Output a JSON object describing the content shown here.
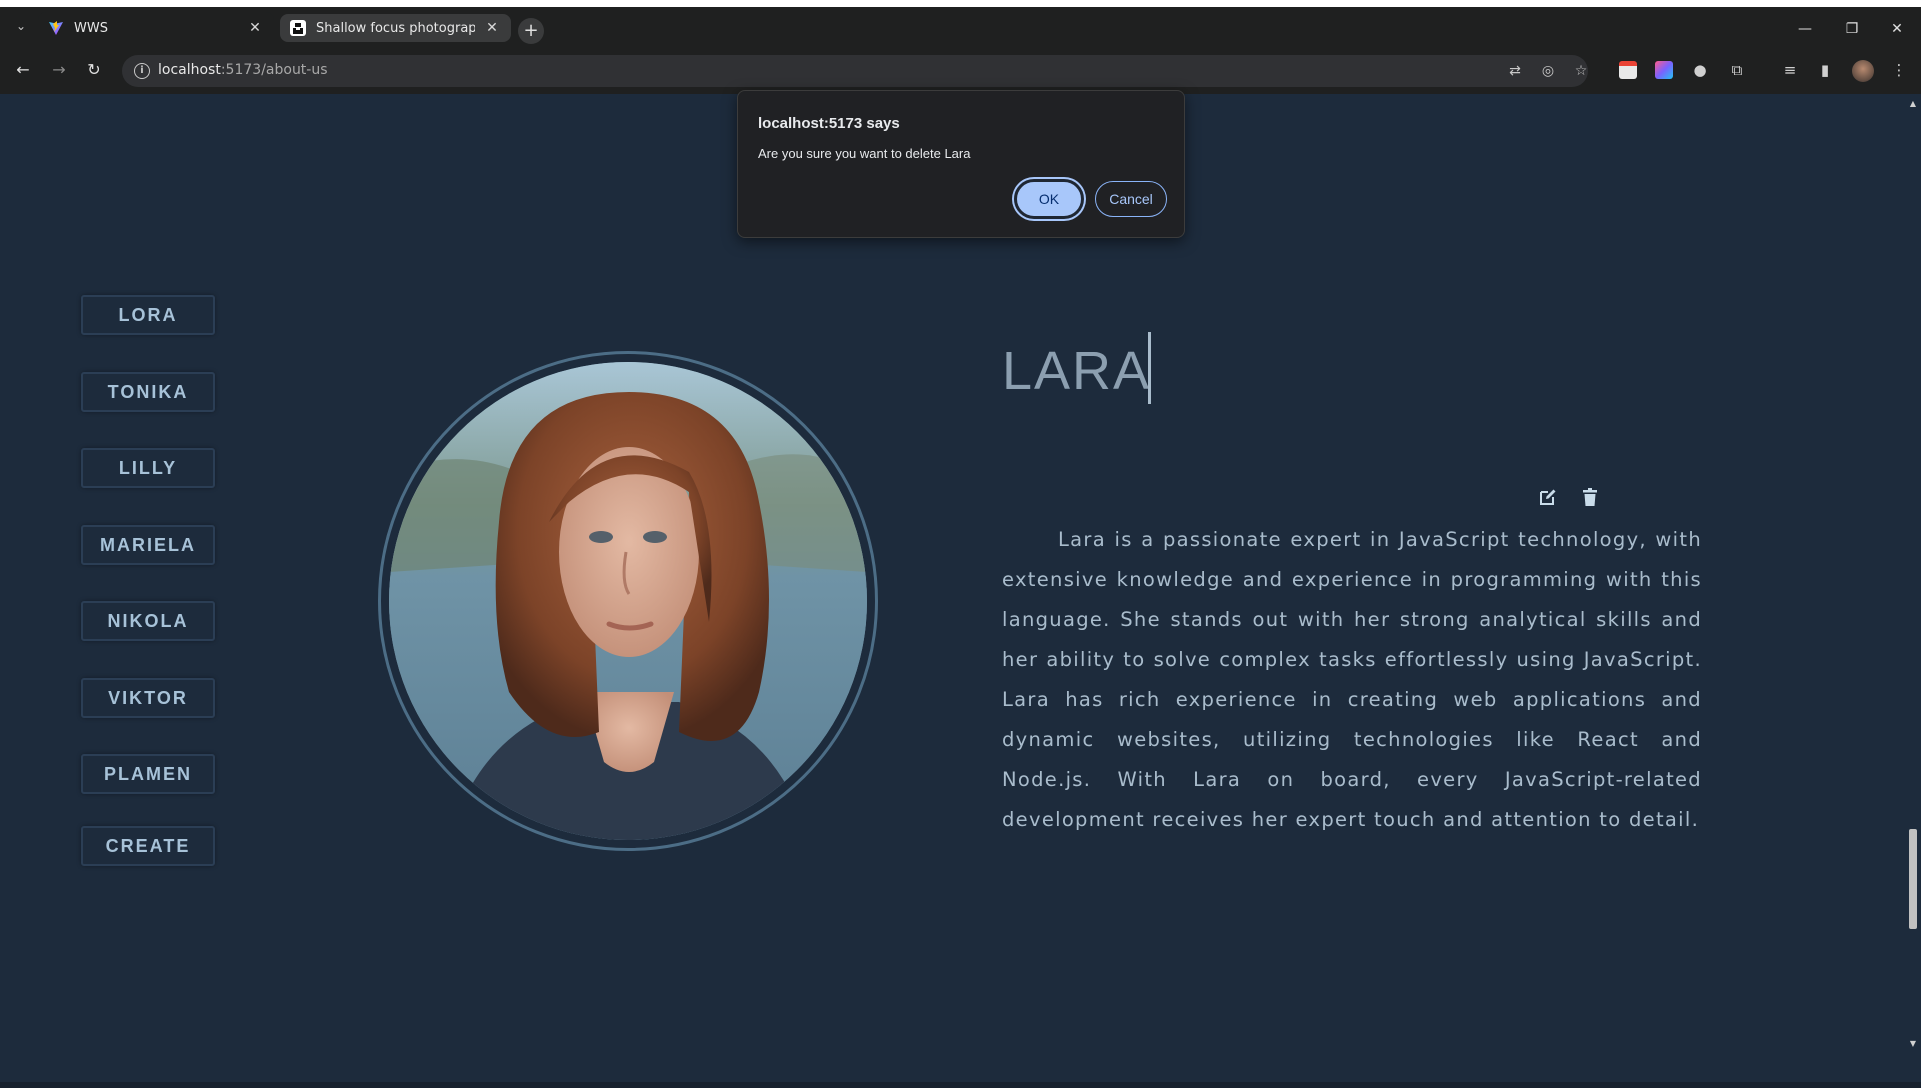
{
  "browser": {
    "tabs": [
      {
        "title": "WWS",
        "active": true
      },
      {
        "title": "Shallow focus photography of w",
        "active": false
      }
    ],
    "url_host": "localhost",
    "url_path": ":5173/about-us"
  },
  "dialog": {
    "title": "localhost:5173 says",
    "message": "Are you sure you want to delete Lara",
    "ok_label": "OK",
    "cancel_label": "Cancel"
  },
  "nav": {
    "items": [
      "LORA",
      "TONIKA",
      "LILLY",
      "MARIELA",
      "NIKOLA",
      "VIKTOR",
      "PLAMEN",
      "CREATE"
    ]
  },
  "profile": {
    "name": "LARA",
    "bio": "Lara is a passionate expert in JavaScript technology, with extensive knowledge and experience in programming with this language. She stands out with her strong analytical skills and her ability to solve complex tasks effortlessly using JavaScript. Lara has rich experience in creating web applications and dynamic websites, utilizing technologies like React and Node.js. With Lara on board, every JavaScript-related development receives her expert touch and attention to detail."
  },
  "colors": {
    "page_background": "#1d2b3c",
    "text": "#a9bccc",
    "dialog_background": "#202124",
    "ok_button": "#a8c7fa"
  }
}
